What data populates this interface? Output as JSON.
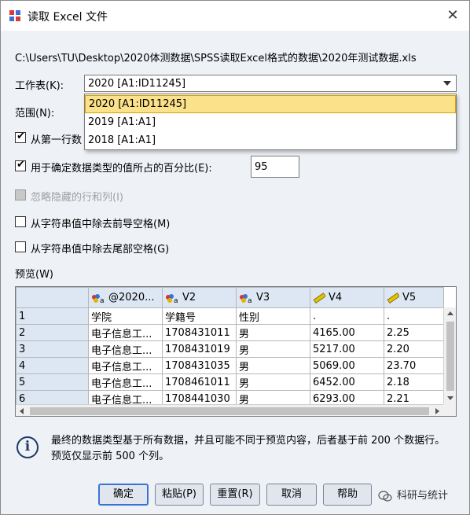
{
  "window": {
    "title": "读取 Excel 文件",
    "close_symbol": "✕"
  },
  "file_path": "C:\\Users\\TU\\Desktop\\2020体测数据\\SPSS读取Excel格式的数据\\2020年测试数据.xls",
  "worksheet": {
    "label": "工作表(K):",
    "selected": "2020 [A1:ID11245]",
    "options": [
      "2020 [A1:ID11245]",
      "2019 [A1:A1]",
      "2018 [A1:A1]"
    ]
  },
  "range_label": "范围(N):",
  "options": {
    "first_row": {
      "label": "从第一行数",
      "checked": true
    },
    "percent": {
      "label": "用于确定数据类型的值所占的百分比(E):",
      "checked": true,
      "value": "95"
    },
    "ignore_hidden": {
      "label": "忽略隐藏的行和列(I)",
      "checked": false,
      "disabled": true
    },
    "remove_leading": {
      "label": "从字符串值中除去前导空格(M)",
      "checked": false
    },
    "remove_trailing": {
      "label": "从字符串值中除去尾部空格(G)",
      "checked": false
    }
  },
  "preview": {
    "label": "预览(W)",
    "columns": [
      {
        "name": "@2020...",
        "icon": "nominal-string-icon"
      },
      {
        "name": "V2",
        "icon": "nominal-string-icon"
      },
      {
        "name": "V3",
        "icon": "nominal-string-icon"
      },
      {
        "name": "V4",
        "icon": "scale-ruler-icon"
      },
      {
        "name": "V5",
        "icon": "scale-ruler-icon"
      }
    ],
    "rows": [
      {
        "n": "1",
        "cells": [
          "学院",
          "学籍号",
          "性别",
          ".",
          "."
        ]
      },
      {
        "n": "2",
        "cells": [
          "电子信息工...",
          "1708431011",
          "男",
          "4165.00",
          "2.25"
        ]
      },
      {
        "n": "3",
        "cells": [
          "电子信息工...",
          "1708431019",
          "男",
          "5217.00",
          "2.20"
        ]
      },
      {
        "n": "4",
        "cells": [
          "电子信息工...",
          "1708431035",
          "男",
          "5069.00",
          "23.70"
        ]
      },
      {
        "n": "5",
        "cells": [
          "电子信息工...",
          "1708461011",
          "男",
          "6452.00",
          "2.18"
        ]
      },
      {
        "n": "6",
        "cells": [
          "电子信息工...",
          "1708441030",
          "男",
          "6293.00",
          "2.21"
        ]
      }
    ]
  },
  "info": "最终的数据类型基于所有数据，并且可能不同于预览内容，后者基于前 200 个数据行。预览仅显示前 500 个列。",
  "buttons": {
    "ok": "确定",
    "paste": "粘贴(P)",
    "reset": "重置(R)",
    "cancel": "取消",
    "help": "帮助"
  },
  "watermark": "科研与统计",
  "colors": {
    "dialog_bg": "#eef1f6",
    "selection": "#fbe18a",
    "default_button_border": "#3874d8",
    "header_bg": "#dde7f3"
  }
}
